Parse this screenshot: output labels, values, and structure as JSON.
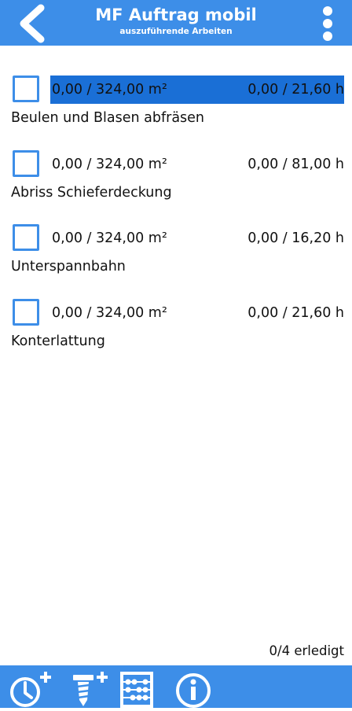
{
  "header": {
    "title": "MF Auftrag mobil",
    "subtitle": "auszuführende Arbeiten",
    "back_icon": "chevron-left-icon",
    "menu_icon": "more-vertical-icon"
  },
  "tasks": [
    {
      "area": "0,00 / 324,00 m²",
      "hours": "0,00 / 21,60 h",
      "name": "Beulen und Blasen abfräsen",
      "checked": false,
      "selected": true
    },
    {
      "area": "0,00 / 324,00 m²",
      "hours": "0,00 / 81,00 h",
      "name": "Abriss Schieferdeckung",
      "checked": false,
      "selected": false
    },
    {
      "area": "0,00 / 324,00 m²",
      "hours": "0,00 / 16,20 h",
      "name": "Unterspannbahn",
      "checked": false,
      "selected": false
    },
    {
      "area": "0,00 / 324,00 m²",
      "hours": "0,00 / 21,60 h",
      "name": "Konterlattung",
      "checked": false,
      "selected": false
    }
  ],
  "status": "0/4 erledigt",
  "bottom_bar": {
    "icons": [
      "clock-add-icon",
      "screw-add-icon",
      "abacus-icon",
      "info-icon"
    ]
  },
  "colors": {
    "primary": "#3d8ee8",
    "highlight": "#1a6fd6",
    "background": "#ffffff",
    "text": "#111111"
  }
}
